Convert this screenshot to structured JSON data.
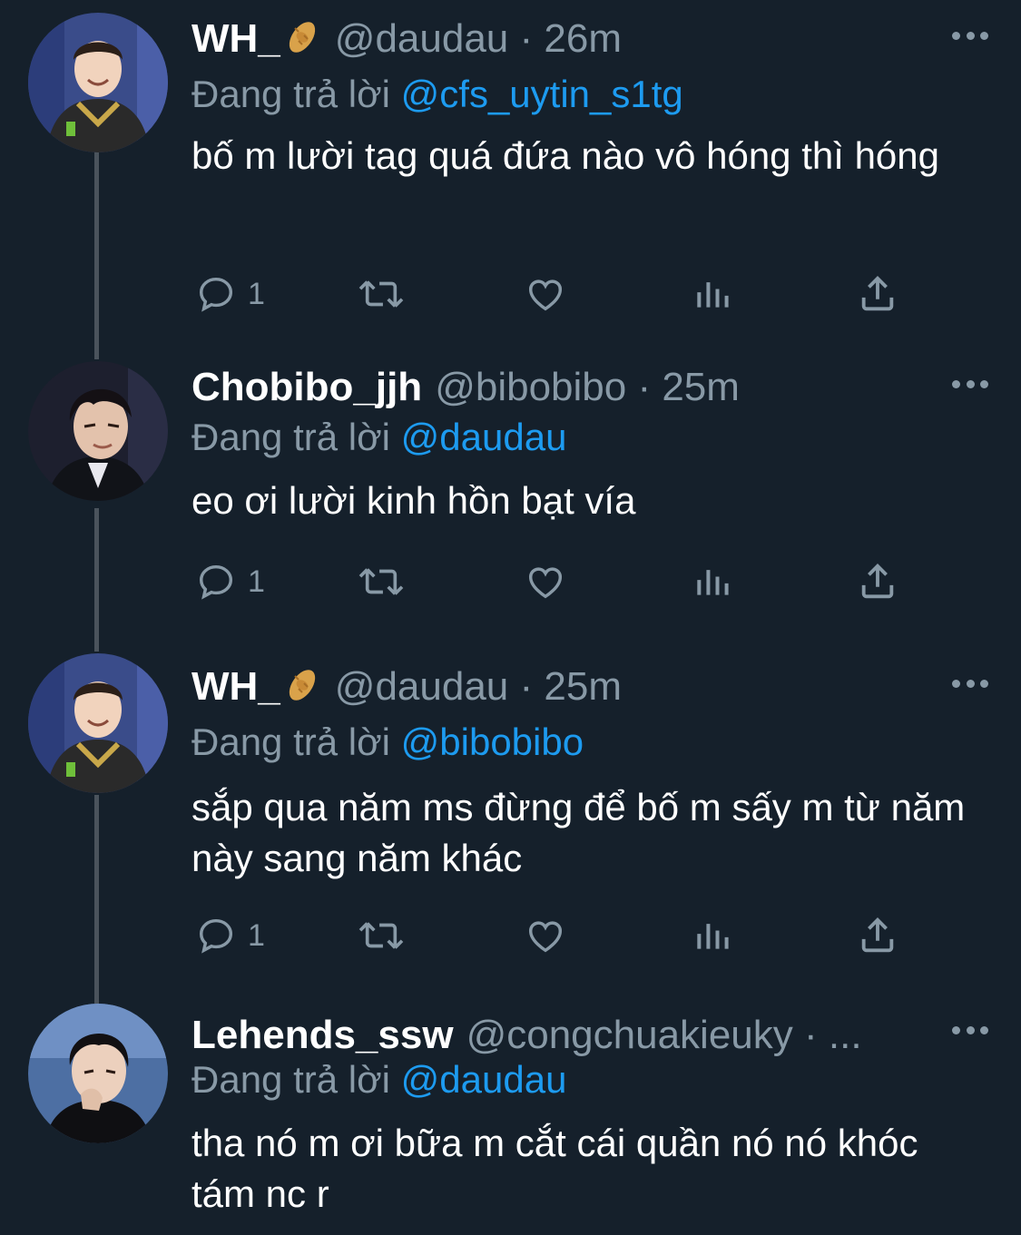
{
  "tweets": [
    {
      "display_name": "WH_",
      "name_emoji": "peanut-emoji",
      "handle_time": "@daudau · 26m",
      "reply_prefix": "Đang trả lời",
      "reply_to": "@cfs_uytin_s1tg",
      "body": "bố m lười tag quá đứa nào vô hóng thì hóng",
      "reply_count": "1",
      "avatar": "avatar-photo-smiling-player-jersey"
    },
    {
      "display_name": "Chobibo_jjh",
      "name_emoji": "",
      "handle_time": "@bibobibo · 25m",
      "reply_prefix": "Đang trả lời",
      "reply_to": "@daudau",
      "body": "eo ơi lười kinh hồn bạt vía",
      "reply_count": "1",
      "avatar": "avatar-photo-suit"
    },
    {
      "display_name": "WH_",
      "name_emoji": "peanut-emoji",
      "handle_time": "@daudau · 25m",
      "reply_prefix": "Đang trả lời",
      "reply_to": "@bibobibo",
      "body": "sắp qua năm ms đừng để bố m sấy m từ năm này sang năm khác",
      "reply_count": "1",
      "avatar": "avatar-photo-smiling-player-jersey"
    },
    {
      "display_name": "Lehends_ssw",
      "name_emoji": "",
      "handle_time": "@congchuakieuky · ...",
      "reply_prefix": "Đang trả lời",
      "reply_to": "@daudau",
      "body": "tha nó m ơi bữa m cắt cái quần nó nó khóc tám nc r",
      "reply_count": "",
      "avatar": "avatar-photo-hand-on-chin"
    }
  ],
  "icons": [
    "reply-icon",
    "retweet-icon",
    "like-icon",
    "views-icon",
    "share-icon",
    "more-icon"
  ],
  "colors": {
    "background": "#15202b",
    "text": "#ffffff",
    "muted": "#8899a6",
    "mention": "#1d9bf0",
    "thread_line": "#4a535c"
  }
}
